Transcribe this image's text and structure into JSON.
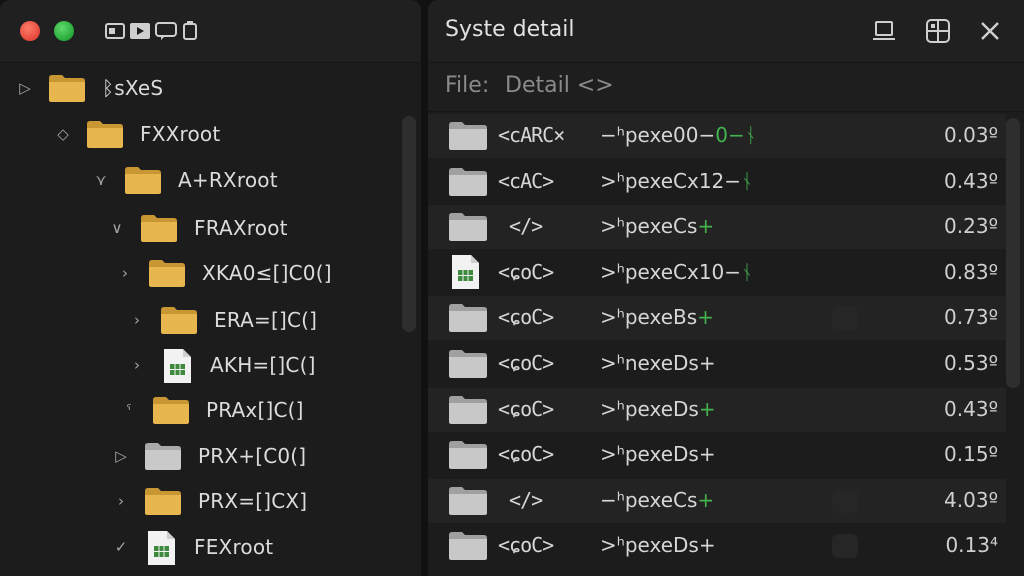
{
  "window": {
    "title": "Syste detail"
  },
  "path": {
    "label": "File:",
    "value": "Detail <>"
  },
  "tree": [
    {
      "label": "ᛒsXeS",
      "chevron": "▷",
      "icon": "folder"
    },
    {
      "label": "FXXroot",
      "chevron": "◇",
      "icon": "folder"
    },
    {
      "label": "A+RXroot",
      "chevron": "⋎",
      "icon": "folder"
    },
    {
      "label": "FRAXroot",
      "chevron": "∨",
      "icon": "folder"
    },
    {
      "label": "XKA0≤[]C0(]",
      "chevron": "›",
      "icon": "folder"
    },
    {
      "label": "ERA=[]C(]",
      "chevron": "›",
      "icon": "folder"
    },
    {
      "label": "AKH=[]C(]",
      "chevron": "›",
      "icon": "doc"
    },
    {
      "label": "PRAx[]C(]",
      "chevron": "ˤ",
      "icon": "folder"
    },
    {
      "label": "PRX+[C0(]",
      "chevron": "▷",
      "icon": "folder-gray"
    },
    {
      "label": "PRX=[]CX]",
      "chevron": "›",
      "icon": "folder"
    },
    {
      "label": "FEXroot",
      "chevron": "✓",
      "icon": "doc"
    }
  ],
  "files": [
    {
      "name": "<cARC×",
      "type_main": "−ʰpexe00−",
      "type_accent": "0−ᚾ",
      "size": "0.03º",
      "icon": "folder"
    },
    {
      "name": "<cAC>",
      "type_main": ">ʰpexeCx12−",
      "type_accent": "ᚾ",
      "size": "0.43º",
      "icon": "folder"
    },
    {
      "name": " </>",
      "type_main": ">ʰpexeCs",
      "type_accent": "+",
      "size": "0.23º",
      "icon": "folder"
    },
    {
      "name": "<ɕoC>",
      "type_main": ">ʰpexeCx10−",
      "type_accent": "ᚾ",
      "size": "0.83º",
      "icon": "doc"
    },
    {
      "name": "<ɕoC>",
      "type_main": ">ʰpexeBs",
      "type_accent": "+",
      "size": "0.73º",
      "icon": "folder"
    },
    {
      "name": "<ɕoC>",
      "type_main": ">ʰnexeDs+",
      "type_accent": "",
      "size": "0.53º",
      "icon": "folder"
    },
    {
      "name": "<ɕoC>",
      "type_main": ">ʰpexeDs",
      "type_accent": "+",
      "size": "0.43º",
      "icon": "folder"
    },
    {
      "name": "<ɕoC>",
      "type_main": ">ʰpexeDs+",
      "type_accent": "",
      "size": "0.15º",
      "icon": "folder"
    },
    {
      "name": " </>",
      "type_main": "−ʰpexeCs",
      "type_accent": "+",
      "size": "4.03º",
      "icon": "folder"
    },
    {
      "name": "<ɕoC>",
      "type_main": ">ʰpexeDs+",
      "type_accent": "",
      "size": "0.13⁴",
      "icon": "folder"
    }
  ],
  "colors": {
    "accent_green": "#43b34f",
    "folder_yellow": "#e7b64f",
    "traffic_red": "#e4483a",
    "traffic_green": "#26a83a"
  }
}
